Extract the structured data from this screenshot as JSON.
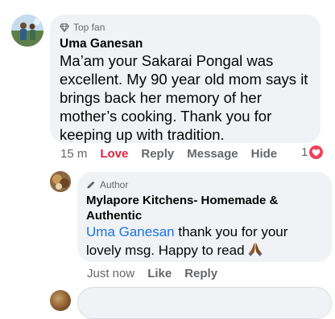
{
  "comment": {
    "badge_label": "Top fan",
    "badge_icon": "diamond-icon",
    "author": "Uma Ganesan",
    "text": "Ma’am your Sakarai Pongal was excellent.  My 90 year old mom says it brings back her memory of her mother’s cooking.  Thank you for keeping up with tradition.",
    "actions": {
      "time": "15 m",
      "love": "Love",
      "reply": "Reply",
      "message": "Message",
      "hide": "Hide"
    },
    "reaction_count": "1",
    "reaction_icon": "heart-icon",
    "love_color": "#e41e3f"
  },
  "reply": {
    "badge_label": "Author",
    "badge_icon": "pencil-icon",
    "author": "Mylapore Kitchens- Homemade & Authentic",
    "mention": "Uma Ganesan",
    "text": " thank you for your lovely msg. Happy to read",
    "emoji": "folded-hands-emoji",
    "actions": {
      "time": "Just now",
      "like": "Like",
      "reply": "Reply"
    }
  },
  "colors": {
    "bubble": "#f0f2f5",
    "mention": "#1b74e4",
    "secondary_text": "#65676b",
    "heart_badge": "#f33e58"
  }
}
